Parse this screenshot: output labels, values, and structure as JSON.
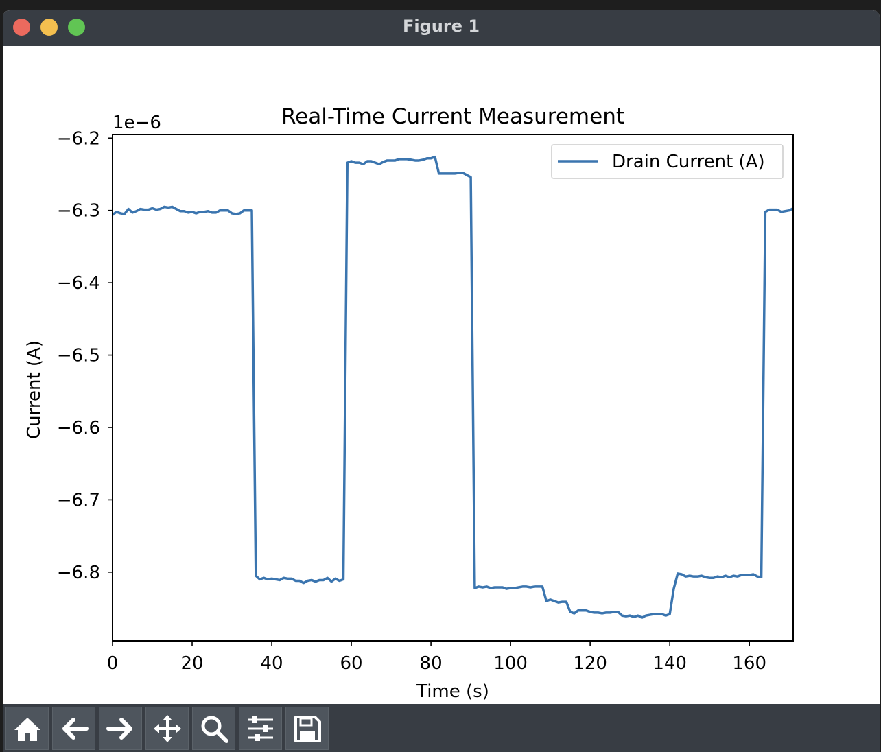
{
  "window": {
    "title": "Figure 1"
  },
  "toolbar": {
    "buttons": [
      {
        "name": "home",
        "icon": "home-icon"
      },
      {
        "name": "back",
        "icon": "arrow-left-icon"
      },
      {
        "name": "forward",
        "icon": "arrow-right-icon"
      },
      {
        "name": "pan",
        "icon": "move-icon"
      },
      {
        "name": "zoom",
        "icon": "magnifier-icon"
      },
      {
        "name": "configure",
        "icon": "sliders-icon"
      },
      {
        "name": "save",
        "icon": "floppy-disk-icon"
      }
    ]
  },
  "chart_data": {
    "type": "line",
    "title": "Real-Time Current Measurement",
    "xlabel": "Time (s)",
    "ylabel": "Current (A)",
    "offset_label": "1e−6",
    "xlim": [
      0,
      171
    ],
    "ylim": [
      -6.895,
      -6.195
    ],
    "xticks": [
      0,
      20,
      40,
      60,
      80,
      100,
      120,
      140,
      160
    ],
    "yticks": [
      -6.2,
      -6.3,
      -6.4,
      -6.5,
      -6.6,
      -6.7,
      -6.8
    ],
    "ytick_labels": [
      "−6.2",
      "−6.3",
      "−6.4",
      "−6.5",
      "−6.6",
      "−6.7",
      "−6.8"
    ],
    "grid": false,
    "legend_position": "top-right",
    "line_color": "#3b75af",
    "series": [
      {
        "name": "Drain Current (A)",
        "x": [
          0,
          1,
          2,
          3,
          4,
          5,
          6,
          7,
          8,
          9,
          10,
          11,
          12,
          13,
          14,
          15,
          16,
          17,
          18,
          19,
          20,
          21,
          22,
          23,
          24,
          25,
          26,
          27,
          28,
          29,
          30,
          31,
          32,
          33,
          34,
          35,
          36,
          37,
          38,
          39,
          40,
          41,
          42,
          43,
          44,
          45,
          46,
          47,
          48,
          49,
          50,
          51,
          52,
          53,
          54,
          55,
          56,
          57,
          58,
          59,
          60,
          61,
          62,
          63,
          64,
          65,
          66,
          67,
          68,
          69,
          70,
          71,
          72,
          73,
          74,
          75,
          76,
          77,
          78,
          79,
          80,
          81,
          82,
          83,
          84,
          85,
          86,
          87,
          88,
          89,
          90,
          91,
          92,
          93,
          94,
          95,
          96,
          97,
          98,
          99,
          100,
          101,
          102,
          103,
          104,
          105,
          106,
          107,
          108,
          109,
          110,
          111,
          112,
          113,
          114,
          115,
          116,
          117,
          118,
          119,
          120,
          121,
          122,
          123,
          124,
          125,
          126,
          127,
          128,
          129,
          130,
          131,
          132,
          133,
          134,
          135,
          136,
          137,
          138,
          139,
          140,
          141,
          142,
          143,
          144,
          145,
          146,
          147,
          148,
          149,
          150,
          151,
          152,
          153,
          154,
          155,
          156,
          157,
          158,
          159,
          160,
          161,
          162,
          163,
          164,
          165,
          166,
          167,
          168,
          169,
          170,
          171
        ],
        "y": [
          -6.306,
          -6.302,
          -6.304,
          -6.305,
          -6.298,
          -6.303,
          -6.301,
          -6.298,
          -6.299,
          -6.299,
          -6.297,
          -6.299,
          -6.298,
          -6.295,
          -6.296,
          -6.295,
          -6.298,
          -6.301,
          -6.301,
          -6.303,
          -6.302,
          -6.304,
          -6.302,
          -6.302,
          -6.301,
          -6.303,
          -6.303,
          -6.3,
          -6.3,
          -6.3,
          -6.304,
          -6.305,
          -6.304,
          -6.3,
          -6.3,
          -6.3,
          -6.805,
          -6.81,
          -6.808,
          -6.81,
          -6.809,
          -6.81,
          -6.811,
          -6.808,
          -6.809,
          -6.809,
          -6.812,
          -6.812,
          -6.815,
          -6.812,
          -6.811,
          -6.813,
          -6.811,
          -6.811,
          -6.808,
          -6.813,
          -6.809,
          -6.812,
          -6.81,
          -6.234,
          -6.232,
          -6.234,
          -6.234,
          -6.236,
          -6.232,
          -6.232,
          -6.234,
          -6.236,
          -6.233,
          -6.231,
          -6.231,
          -6.231,
          -6.229,
          -6.229,
          -6.229,
          -6.23,
          -6.231,
          -6.231,
          -6.23,
          -6.228,
          -6.228,
          -6.226,
          -6.249,
          -6.249,
          -6.249,
          -6.249,
          -6.249,
          -6.248,
          -6.248,
          -6.251,
          -6.254,
          -6.822,
          -6.82,
          -6.821,
          -6.82,
          -6.822,
          -6.821,
          -6.821,
          -6.821,
          -6.823,
          -6.822,
          -6.822,
          -6.821,
          -6.82,
          -6.82,
          -6.821,
          -6.82,
          -6.82,
          -6.82,
          -6.84,
          -6.838,
          -6.84,
          -6.842,
          -6.841,
          -6.841,
          -6.855,
          -6.857,
          -6.853,
          -6.853,
          -6.853,
          -6.855,
          -6.856,
          -6.856,
          -6.857,
          -6.856,
          -6.856,
          -6.855,
          -6.855,
          -6.86,
          -6.861,
          -6.86,
          -6.862,
          -6.86,
          -6.863,
          -6.86,
          -6.859,
          -6.858,
          -6.858,
          -6.858,
          -6.86,
          -6.858,
          -6.823,
          -6.802,
          -6.803,
          -6.806,
          -6.805,
          -6.806,
          -6.806,
          -6.805,
          -6.807,
          -6.808,
          -6.808,
          -6.806,
          -6.807,
          -6.805,
          -6.807,
          -6.805,
          -6.806,
          -6.804,
          -6.804,
          -6.804,
          -6.803,
          -6.806,
          -6.807,
          -6.302,
          -6.299,
          -6.299,
          -6.299,
          -6.302,
          -6.301,
          -6.3,
          -6.297
        ]
      }
    ]
  }
}
